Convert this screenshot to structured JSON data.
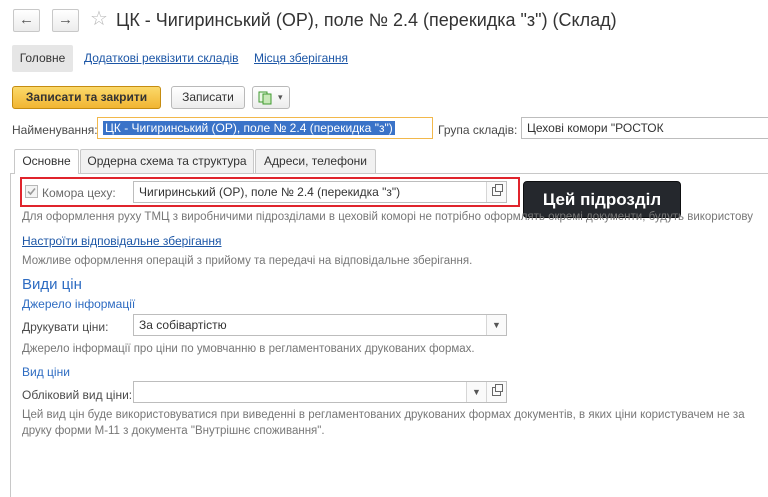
{
  "header": {
    "back_glyph": "←",
    "forward_glyph": "→",
    "star_glyph": "☆",
    "title": "ЦК - Чигиринський (ОР), поле № 2.4 (перекидка \"з\") (Склад)"
  },
  "sections": {
    "main": "Головне",
    "extra": "Додаткові реквізити складів",
    "storage": "Місця зберігання"
  },
  "toolbar": {
    "save_close": "Записати та закрити",
    "save": "Записати",
    "more_glyph": "▾"
  },
  "form": {
    "name_label": "Найменування:",
    "name_value": "ЦК - Чигиринський (ОР), поле № 2.4 (перекидка \"з\")",
    "group_label": "Група складів:",
    "group_value": "Цехові комори \"РОСТОК"
  },
  "tabs": [
    "Основне",
    "Ордерна схема та структура",
    "Адреси, телефони"
  ],
  "main_tab": {
    "workshop_label": "Комора цеху:",
    "workshop_value": "Чигиринський (ОР), поле № 2.4 (перекидка \"з\")",
    "workshop_checked": true,
    "hint_workshop": "Для оформлення руху ТМЦ з виробничими підрозділами в цеховій коморі не потрібно оформлять окремі документи, будуть використову",
    "responsible_link": "Настроїти відповідальне зберігання",
    "hint_responsible": "Можливе оформлення операцій з прийому та передачі на відповідальне зберігання.",
    "prices_head": "Види цін",
    "source_head": "Джерело інформації",
    "print_prices_label": "Друкувати ціни:",
    "print_prices_value": "За собівартістю",
    "hint_print": "Джерело інформації про ціни по умовчанню в регламентованих друкованих формах.",
    "price_type_head": "Вид ціни",
    "account_price_label": "Обліковий вид ціни:",
    "account_price_value": "",
    "hint_price_1": "Цей вид цін буде використовуватися при виведенні в регламентованих друкованих формах документів, в яких ціни користувачем не за",
    "hint_price_2": "друку форми М-11 з документа \"Внутрішнє споживання\"."
  },
  "tooltip": "Цей підрозділ"
}
